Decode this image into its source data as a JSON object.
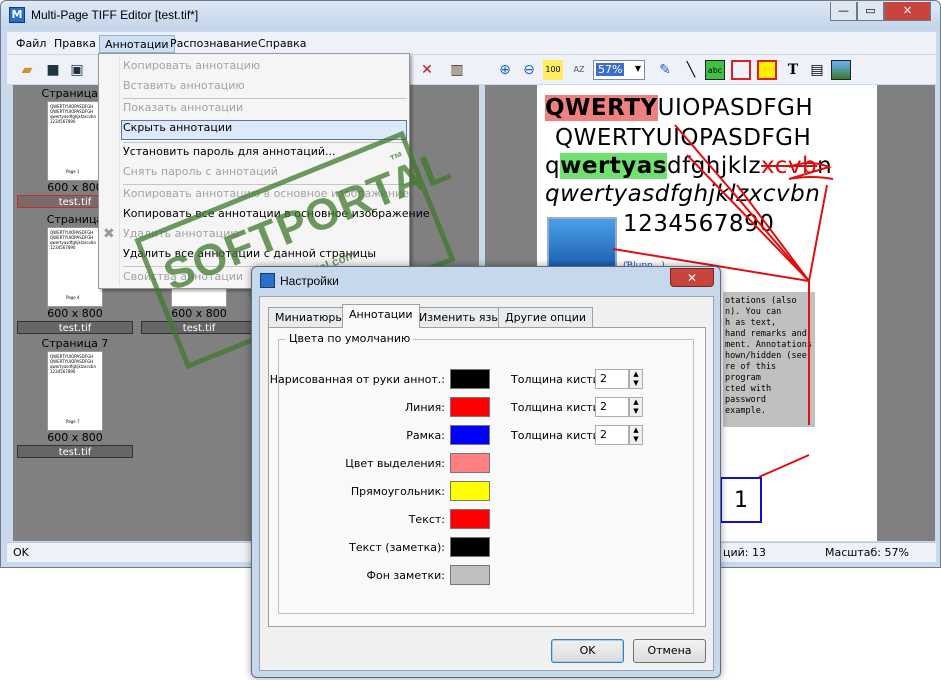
{
  "app": {
    "title": "Multi-Page TIFF Editor [test.tif*]",
    "icon_glyph": "M"
  },
  "window_buttons": {
    "minimize": "—",
    "maximize": "▭",
    "close": "✕"
  },
  "menu": {
    "items": [
      "Файл",
      "Правка",
      "Аннотации",
      "Распознавание",
      "Справка"
    ]
  },
  "toolbar": {
    "zoom_value": "57%",
    "icons": [
      "open-folder-icon",
      "save-icon",
      "save-all-icon",
      "delete-icon",
      "export-icon",
      "zoom-in-icon",
      "zoom-out-icon",
      "fit-100-icon",
      "fit-az-icon",
      "pen-icon",
      "line-icon",
      "abc-highlight-icon",
      "rectangle-icon",
      "filled-rect-icon",
      "text-icon",
      "note-icon",
      "image-icon"
    ]
  },
  "thumbnails": [
    {
      "title": "Страница 1",
      "dims": "600 x 800",
      "name": "test.tif"
    },
    {
      "title": "Страница",
      "dims": "600 x 800",
      "name": "test.tif"
    },
    {
      "title": "",
      "dims": "600 x 800",
      "name": "test.tif"
    },
    {
      "title": "Страница 7",
      "dims": "600 x 800",
      "name": "test.tif"
    }
  ],
  "thumb_text": {
    "p1": "Page 1",
    "p4": "Page 4",
    "p7": "Page 7",
    "lines": "QWERTYUIOPASDFGH QWERTYUIOPASDFGH qwertyasdfghjklzxcvbn 1234567890"
  },
  "dropdown": {
    "items": [
      {
        "label": "Копировать аннотацию",
        "enabled": false
      },
      {
        "label": "Вставить аннотацию",
        "enabled": false
      },
      {
        "label": "Показать аннотации",
        "enabled": false
      },
      {
        "label": "Скрыть аннотации",
        "enabled": true
      },
      {
        "label": "Установить пароль для аннотаций...",
        "enabled": true
      },
      {
        "label": "Снять пароль с аннотаций",
        "enabled": false
      },
      {
        "label": "Копировать аннотацию в основное изображение",
        "enabled": false
      },
      {
        "label": "Копировать все аннотации в основное изображение",
        "enabled": true
      },
      {
        "label": "Удалить аннотацию",
        "enabled": false
      },
      {
        "label": "Удалить все аннотации с данной страницы",
        "enabled": true
      },
      {
        "label": "Свойства аннотации",
        "enabled": false
      }
    ]
  },
  "document": {
    "line1_hl": "QWERTY",
    "line1_rest": "UIOPASDFGH",
    "line2": "QWERTYUIOPASDFGH",
    "line3_a": "q",
    "line3_hl": "wertyas",
    "line3_rest": "dfghjklz",
    "line3_strike": "xcvb",
    "line3_end": "n",
    "line4": "qwertyasdfghjklzxcvbn",
    "line5": "1234567890",
    "link_text": "(Ɓlunn...)",
    "note_lines": [
      "otations (also",
      "n). You can",
      "h as text,",
      "hand remarks and",
      "ment. Annotations",
      "hown/hidden (see",
      "re of this program",
      "cted with password",
      "example."
    ],
    "box_number": "1"
  },
  "status": {
    "left": "OK",
    "mid_prefix": "ций: 13",
    "zoom": "Масштаб: 57%"
  },
  "watermark": {
    "text": "SOFTPORTAL",
    "tm": "™",
    "url": "www.softportal.com"
  },
  "dialog": {
    "title": "Настройки",
    "close": "✕",
    "tabs": [
      "Миниатюры",
      "Аннотации",
      "Изменить язык",
      "Другие опции"
    ],
    "active_tab": 1,
    "group_title": "Цвета по умолчанию",
    "rows": [
      {
        "label": "Нарисованная от руки аннот.:",
        "color": "#000000",
        "width_label": "Толщина кисти:",
        "width": "2"
      },
      {
        "label": "Линия:",
        "color": "#ff0000",
        "width_label": "Толщина кисти:",
        "width": "2"
      },
      {
        "label": "Рамка:",
        "color": "#0000ff",
        "width_label": "Толщина кисти:",
        "width": "2"
      },
      {
        "label": "Цвет выделения:",
        "color": "#ff8080"
      },
      {
        "label": "Прямоугольник:",
        "color": "#ffff00"
      },
      {
        "label": "Текст:",
        "color": "#ff0000"
      },
      {
        "label": "Текст (заметка):",
        "color": "#000000"
      },
      {
        "label": "Фон заметки:",
        "color": "#c0c0c0"
      }
    ],
    "ok": "OK",
    "cancel": "Отмена"
  }
}
